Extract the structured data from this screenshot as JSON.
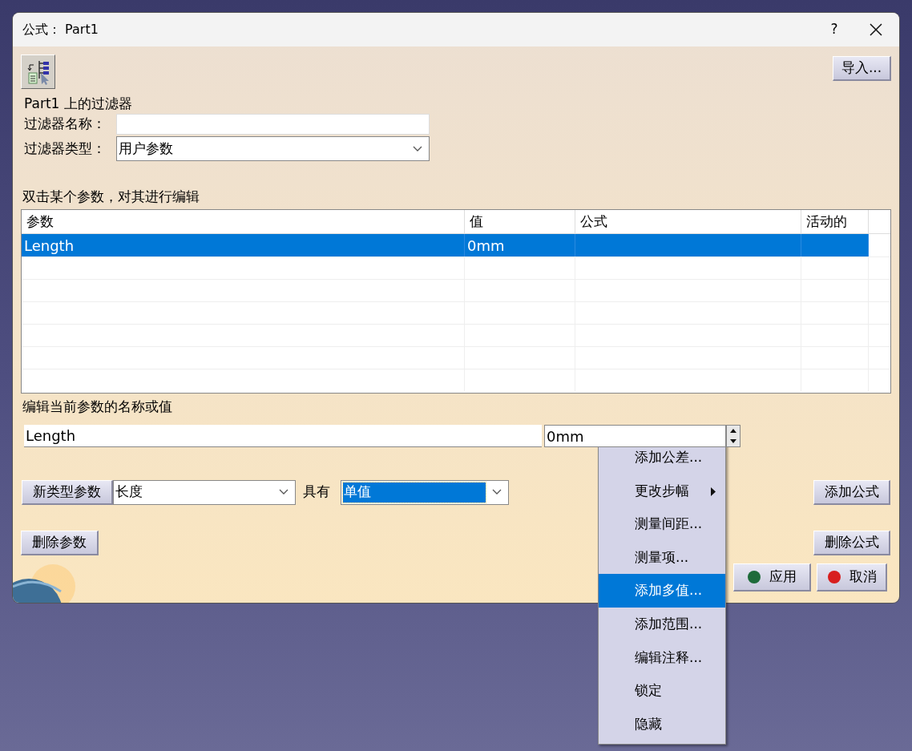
{
  "window": {
    "title": "公式： Part1",
    "help": "?"
  },
  "import_button": "导入...",
  "filter_heading": "Part1 上的过滤器",
  "filter_name": {
    "label": "过滤器名称："
  },
  "filter_type": {
    "label": "过滤器类型：",
    "value": "用户参数"
  },
  "table_hint": "双击某个参数，对其进行编辑",
  "table": {
    "columns": [
      "参数",
      "值",
      "公式",
      "活动的"
    ],
    "rows": [
      {
        "cells": [
          "Length",
          "0mm",
          "",
          ""
        ],
        "selected": true
      }
    ]
  },
  "edit_label": "编辑当前参数的名称或值",
  "edit_name": {
    "value": "Length"
  },
  "edit_value": {
    "value": "0mm"
  },
  "new_param_button": "新类型参数",
  "param_type": {
    "value": "长度"
  },
  "with_label": "具有",
  "value_kind": {
    "value": "单值",
    "highlighted": true
  },
  "add_formula_button": "添加公式",
  "delete_param_button": "删除参数",
  "delete_formula_button": "删除公式",
  "apply_button": {
    "label": "应用",
    "color": "#1e6b3a"
  },
  "cancel_button": {
    "label": "取消",
    "color": "#d81e1e"
  },
  "context_menu": [
    {
      "label": "添加公差...",
      "submenu": false,
      "selected": false
    },
    {
      "label": "更改步幅",
      "submenu": true,
      "selected": false
    },
    {
      "label": "测量间距...",
      "submenu": false,
      "selected": false
    },
    {
      "label": "测量项...",
      "submenu": false,
      "selected": false
    },
    {
      "label": "添加多值...",
      "submenu": false,
      "selected": true
    },
    {
      "label": "添加范围...",
      "submenu": false,
      "selected": false
    },
    {
      "label": "编辑注释...",
      "submenu": false,
      "selected": false
    },
    {
      "label": "锁定",
      "submenu": false,
      "selected": false
    },
    {
      "label": "隐藏",
      "submenu": false,
      "selected": false
    }
  ]
}
